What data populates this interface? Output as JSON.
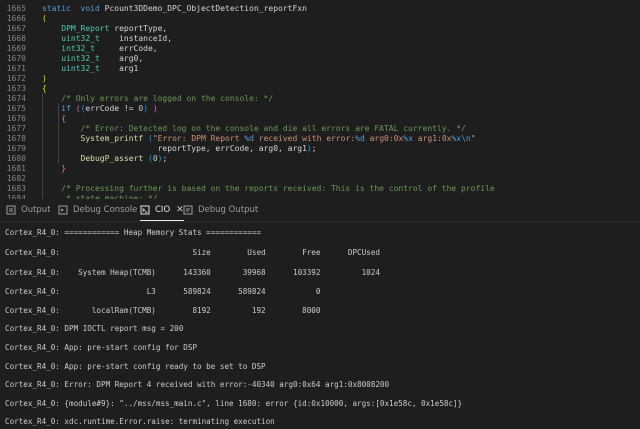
{
  "editor": {
    "lines": [
      {
        "no": "1665",
        "segs": [
          [
            "kw",
            "static"
          ],
          [
            "",
            "  "
          ],
          [
            "kw",
            "void"
          ],
          [
            "",
            " Pcount3DDemo_DPC_ObjectDetection_reportFxn"
          ]
        ]
      },
      {
        "no": "1666",
        "segs": [
          [
            "py",
            "("
          ]
        ]
      },
      {
        "no": "1667",
        "segs": [
          [
            "",
            "    "
          ],
          [
            "ty",
            "DPM_Report"
          ],
          [
            "",
            " reportType,"
          ]
        ]
      },
      {
        "no": "1668",
        "segs": [
          [
            "",
            "    "
          ],
          [
            "ty",
            "uint32_t"
          ],
          [
            "",
            "    instanceId,"
          ]
        ]
      },
      {
        "no": "1669",
        "segs": [
          [
            "",
            "    "
          ],
          [
            "ty",
            "int32_t"
          ],
          [
            "",
            "     errCode,"
          ]
        ]
      },
      {
        "no": "1670",
        "segs": [
          [
            "",
            "    "
          ],
          [
            "ty",
            "uint32_t"
          ],
          [
            "",
            "    arg0,"
          ]
        ]
      },
      {
        "no": "1671",
        "segs": [
          [
            "",
            "    "
          ],
          [
            "ty",
            "uint32_t"
          ],
          [
            "",
            "    arg1"
          ]
        ]
      },
      {
        "no": "1672",
        "segs": [
          [
            "py",
            ")"
          ]
        ]
      },
      {
        "no": "1673",
        "segs": [
          [
            "py",
            "{"
          ]
        ]
      },
      {
        "no": "1674",
        "segs": [
          [
            "",
            "    "
          ],
          [
            "cm",
            "/* Only errors are logged on the console: */"
          ]
        ]
      },
      {
        "no": "1675",
        "segs": [
          [
            "",
            "    "
          ],
          [
            "kw",
            "if"
          ],
          [
            "",
            " "
          ],
          [
            "pb",
            "("
          ],
          [
            "pl",
            "("
          ],
          [
            "",
            "errCode != "
          ],
          [
            "nm",
            "0"
          ],
          [
            "pl",
            ")"
          ],
          [
            "",
            " "
          ],
          [
            "pb",
            ")"
          ]
        ]
      },
      {
        "no": "1676",
        "segs": [
          [
            "",
            "    "
          ],
          [
            "pb",
            "{"
          ]
        ]
      },
      {
        "no": "1677",
        "segs": [
          [
            "",
            "        "
          ],
          [
            "cm",
            "/* Error: Detected log on the console and die all errors are FATAL currently. */"
          ]
        ]
      },
      {
        "no": "1678",
        "segs": [
          [
            "",
            "        "
          ],
          [
            "fn",
            "System_printf"
          ],
          [
            "",
            " "
          ],
          [
            "pl",
            "("
          ],
          [
            "st",
            "\"Error: DPM Report "
          ],
          [
            "fmt",
            "%d"
          ],
          [
            "st",
            " received with error:"
          ],
          [
            "fmt",
            "%d"
          ],
          [
            "st",
            " arg0:0x"
          ],
          [
            "fmt",
            "%x"
          ],
          [
            "st",
            " arg1:0x"
          ],
          [
            "fmt",
            "%x"
          ],
          [
            "fmt",
            "\\n"
          ],
          [
            "st",
            "\""
          ],
          [
            ","
          ]
        ]
      },
      {
        "no": "1679",
        "segs": [
          [
            "",
            "                        reportType, errCode, arg0, arg1"
          ],
          [
            "pl",
            ")"
          ],
          [
            "",
            ";"
          ]
        ]
      },
      {
        "no": "1680",
        "segs": [
          [
            "",
            "        "
          ],
          [
            "fn",
            "DebugP_assert"
          ],
          [
            "",
            " "
          ],
          [
            "pl",
            "("
          ],
          [
            "nm",
            "0"
          ],
          [
            "pl",
            ")"
          ],
          [
            "",
            ";"
          ]
        ]
      },
      {
        "no": "1681",
        "segs": [
          [
            "",
            "    "
          ],
          [
            "pb",
            "}"
          ]
        ]
      },
      {
        "no": "1682",
        "segs": [
          [
            "",
            ""
          ]
        ]
      },
      {
        "no": "1683",
        "segs": [
          [
            "",
            "    "
          ],
          [
            "cm",
            "/* Processing further is based on the reports received: This is the control of the profile"
          ]
        ]
      },
      {
        "no": "1684",
        "segs": [
          [
            "",
            "     "
          ],
          [
            "cm",
            "* state machine: */"
          ]
        ]
      }
    ]
  },
  "tabs": [
    {
      "label": "Output",
      "icon": "output-icon"
    },
    {
      "label": "Debug Console",
      "icon": "debug-console-icon"
    },
    {
      "label": "CIO",
      "icon": "terminal-icon",
      "close": "✕"
    },
    {
      "label": "Debug Output",
      "icon": "debug-output-icon"
    }
  ],
  "console": {
    "lines": [
      "Cortex_R4_0: ============ Heap Memory Stats ============",
      "Cortex_R4_0:                             Size        Used        Free      DPCUsed",
      "Cortex_R4_0:    System Heap(TCMB)      143360       39968      103392         1024",
      "Cortex_R4_0:                   L3      589824      589824           0",
      "Cortex_R4_0:       localRam(TCMB)        8192         192        8000",
      "Cortex_R4_0: DPM IOCTL report msg = 200",
      "Cortex_R4_0: App: pre-start config for DSP",
      "Cortex_R4_0: App: pre-start config ready to be set to DSP",
      "Cortex_R4_0: Error: DPM Report 4 received with error:-40340 arg0:0x64 arg1:0x8008200",
      "Cortex_R4_0: {module#9}: \"../mss/mss_main.c\", line 1680: error {id:0x10000, args:[0x1e58c, 0x1e58c]}",
      "Cortex_R4_0: xdc.runtime.Error.raise: terminating execution"
    ]
  }
}
